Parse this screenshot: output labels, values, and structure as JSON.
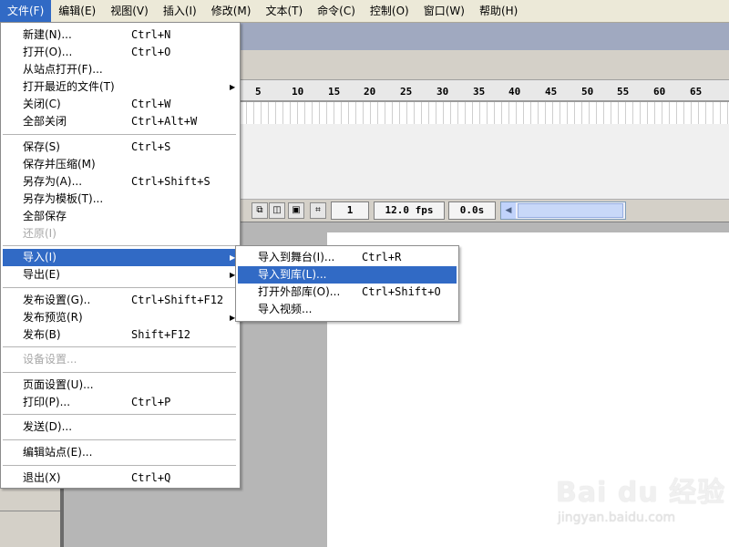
{
  "menubar": [
    {
      "label": "文件(F)"
    },
    {
      "label": "编辑(E)"
    },
    {
      "label": "视图(V)"
    },
    {
      "label": "插入(I)"
    },
    {
      "label": "修改(M)"
    },
    {
      "label": "文本(T)"
    },
    {
      "label": "命令(C)"
    },
    {
      "label": "控制(O)"
    },
    {
      "label": "窗口(W)"
    },
    {
      "label": "帮助(H)"
    }
  ],
  "file_menu": {
    "items": [
      {
        "label": "新建(N)...",
        "shortcut": "Ctrl+N"
      },
      {
        "label": "打开(O)...",
        "shortcut": "Ctrl+O"
      },
      {
        "label": "从站点打开(F)...",
        "shortcut": ""
      },
      {
        "label": "打开最近的文件(T)",
        "shortcut": ""
      },
      {
        "label": "关闭(C)",
        "shortcut": "Ctrl+W"
      },
      {
        "label": "全部关闭",
        "shortcut": "Ctrl+Alt+W"
      },
      {
        "label": "保存(S)",
        "shortcut": "Ctrl+S"
      },
      {
        "label": "保存并压缩(M)",
        "shortcut": ""
      },
      {
        "label": "另存为(A)...",
        "shortcut": "Ctrl+Shift+S"
      },
      {
        "label": "另存为模板(T)...",
        "shortcut": ""
      },
      {
        "label": "全部保存",
        "shortcut": ""
      },
      {
        "label": "还原(I)",
        "shortcut": ""
      },
      {
        "label": "导入(I)",
        "shortcut": ""
      },
      {
        "label": "导出(E)",
        "shortcut": ""
      },
      {
        "label": "发布设置(G)..",
        "shortcut": "Ctrl+Shift+F12"
      },
      {
        "label": "发布预览(R)",
        "shortcut": ""
      },
      {
        "label": "发布(B)",
        "shortcut": "Shift+F12"
      },
      {
        "label": "设备设置...",
        "shortcut": ""
      },
      {
        "label": "页面设置(U)...",
        "shortcut": ""
      },
      {
        "label": "打印(P)...",
        "shortcut": "Ctrl+P"
      },
      {
        "label": "发送(D)...",
        "shortcut": ""
      },
      {
        "label": "编辑站点(E)...",
        "shortcut": ""
      },
      {
        "label": "退出(X)",
        "shortcut": "Ctrl+Q"
      }
    ]
  },
  "import_submenu": {
    "items": [
      {
        "label": "导入到舞台(I)...",
        "shortcut": "Ctrl+R"
      },
      {
        "label": "导入到库(L)...",
        "shortcut": ""
      },
      {
        "label": "打开外部库(O)...",
        "shortcut": "Ctrl+Shift+O"
      },
      {
        "label": "导入视频...",
        "shortcut": ""
      }
    ]
  },
  "timeline": {
    "ticks": [
      "5",
      "10",
      "15",
      "20",
      "25",
      "30",
      "35",
      "40",
      "45",
      "50",
      "55",
      "60",
      "65"
    ],
    "frame": "1",
    "fps": "12.0 fps",
    "time": "0.0s"
  },
  "watermark": {
    "logo": "Bai du 经验",
    "sub": "jingyan.baidu.com"
  }
}
